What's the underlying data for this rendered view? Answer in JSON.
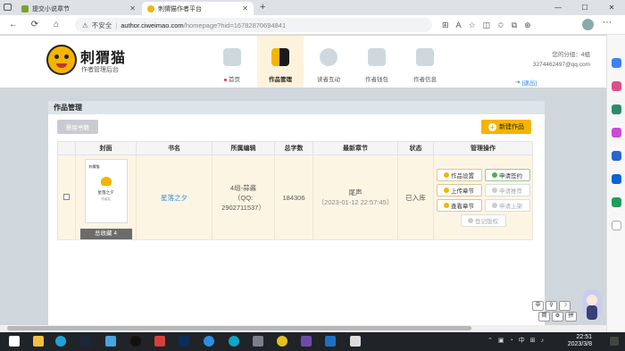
{
  "browser": {
    "tabs": [
      {
        "title": "提交小说章节",
        "active": false
      },
      {
        "title": "刺猬猫作者平台",
        "active": true
      }
    ],
    "new_tab": "+",
    "window_controls": [
      "—",
      "☐",
      "✕"
    ],
    "security_label": "不安全",
    "url_host": "author.ciweimao.com",
    "url_path": "/homepage?hid=16782870694841",
    "nav_buttons": [
      "←",
      "⟳",
      "⌂"
    ]
  },
  "site": {
    "logo_text": "刺猬猫",
    "logo_subtitle": "作者管理后台",
    "nav": [
      {
        "label": "首页",
        "dot": true,
        "active": false
      },
      {
        "label": "作品管理",
        "dot": false,
        "active": true
      },
      {
        "label": "读者互动",
        "dot": false,
        "active": false
      },
      {
        "label": "作者钱包",
        "dot": false,
        "active": false
      },
      {
        "label": "作者信息",
        "dot": false,
        "active": false
      }
    ],
    "user_group": "您的分组：4组",
    "user_email": "3274462497@qq.com",
    "logout": "[退出]",
    "brand_color": "#f5b400"
  },
  "panel": {
    "title": "作品管理",
    "delete_button": "删除书籍",
    "new_button": "新建作品",
    "columns": [
      "",
      "封面",
      "书名",
      "所属编辑",
      "总字数",
      "最新章节",
      "状态",
      "管理操作"
    ],
    "rows": [
      {
        "cover_brand": "刺猬猫",
        "cover_title": "星落之夕",
        "cover_author": "作者名",
        "favorites": "总收藏 4",
        "book_name": "星落之夕",
        "editor_line1": "4组-蒜酱",
        "editor_line2": "（QQ:",
        "editor_line3": "2902711537）",
        "word_count": "184306",
        "latest_chapter": "尾声",
        "latest_time": "（2023-01-12 22:57:45）",
        "status": "已入库",
        "ops": {
          "settings": "作品设置",
          "sign": "申请签约",
          "upload": "上传章节",
          "recommend": "申请推荐",
          "view": "查看章节",
          "shelve": "申请上架",
          "copyright": "登记版权"
        }
      }
    ]
  },
  "overlay": {
    "ime": [
      "中",
      "⚲",
      "☽",
      "⚙",
      "简",
      "⚙",
      "拼"
    ]
  },
  "taskbar": {
    "tray_lang": "中",
    "time": "22:51",
    "date": "2023/3/8"
  }
}
